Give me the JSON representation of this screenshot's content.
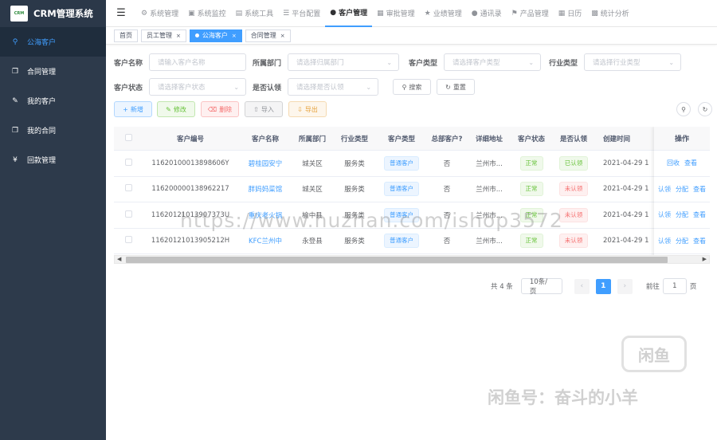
{
  "app": {
    "logo_text": "CRM",
    "title": "CRM管理系统"
  },
  "sidebar": {
    "items": [
      {
        "label": "公海客户",
        "icon": "sitemap-icon"
      },
      {
        "label": "合同管理",
        "icon": "copy-icon"
      },
      {
        "label": "我的客户",
        "icon": "edit-icon"
      },
      {
        "label": "我的合同",
        "icon": "copy-icon"
      },
      {
        "label": "回款管理",
        "icon": "yen-icon"
      }
    ]
  },
  "topnav": {
    "items": [
      {
        "label": "系统管理",
        "icon": "gear-icon"
      },
      {
        "label": "系统监控",
        "icon": "monitor-icon"
      },
      {
        "label": "系统工具",
        "icon": "toolbox-icon"
      },
      {
        "label": "平台配置",
        "icon": "list-icon"
      },
      {
        "label": "客户管理",
        "icon": "user-icon"
      },
      {
        "label": "审批管理",
        "icon": "grid-icon"
      },
      {
        "label": "业绩管理",
        "icon": "star-icon"
      },
      {
        "label": "通讯录",
        "icon": "user-icon"
      },
      {
        "label": "产品管理",
        "icon": "tag-icon"
      },
      {
        "label": "日历",
        "icon": "calendar-icon"
      },
      {
        "label": "统计分析",
        "icon": "bar-chart-icon"
      }
    ]
  },
  "tags": [
    {
      "label": "首页"
    },
    {
      "label": "员工管理",
      "close": "×"
    },
    {
      "label": "公海客户",
      "close": "×"
    },
    {
      "label": "合同管理",
      "close": "×"
    }
  ],
  "filters": {
    "customer_name": {
      "label": "客户名称",
      "placeholder": "请输入客户名称"
    },
    "department": {
      "label": "所属部门",
      "placeholder": "请选择归属部门"
    },
    "customer_type": {
      "label": "客户类型",
      "placeholder": "请选择客户类型"
    },
    "industry_type": {
      "label": "行业类型",
      "placeholder": "请选择行业类型"
    },
    "customer_status": {
      "label": "客户状态",
      "placeholder": "请选择客户状态"
    },
    "claimed": {
      "label": "是否认领",
      "placeholder": "请选择是否认领"
    },
    "search_label": "搜索",
    "reset_label": "重置"
  },
  "toolbar": {
    "add": "新增",
    "edit": "修改",
    "delete": "删除",
    "import": "导入",
    "export": "导出"
  },
  "table": {
    "columns": [
      "客户编号",
      "客户名称",
      "所属部门",
      "行业类型",
      "客户类型",
      "总部客户?",
      "详细地址",
      "客户状态",
      "是否认领",
      "创建时间",
      "操作"
    ],
    "rows": [
      {
        "id": "11620100013898606Y",
        "name": "碧桂园安宁",
        "dept": "城关区",
        "industry": "服务类",
        "type": "普通客户",
        "hq": "否",
        "addr": "兰州市...",
        "status": "正常",
        "claimed": "已认领",
        "created": "2021-04-29 1",
        "ops": [
          "回收",
          "查看"
        ]
      },
      {
        "id": "116200000138962217",
        "name": "胖妈妈菜馆",
        "dept": "城关区",
        "industry": "服务类",
        "type": "普通客户",
        "hq": "否",
        "addr": "兰州市...",
        "status": "正常",
        "claimed": "未认领",
        "created": "2021-04-29 1",
        "ops": [
          "认领",
          "分配",
          "查看"
        ]
      },
      {
        "id": "11620121013907373U",
        "name": "重庆老火锅",
        "dept": "榆中县",
        "industry": "服务类",
        "type": "普通客户",
        "hq": "否",
        "addr": "兰州市...",
        "status": "正常",
        "claimed": "未认领",
        "created": "2021-04-29 1",
        "ops": [
          "认领",
          "分配",
          "查看"
        ]
      },
      {
        "id": "11620121013905212H",
        "name": "KFC兰州中",
        "dept": "永登县",
        "industry": "服务类",
        "type": "普通客户",
        "hq": "否",
        "addr": "兰州市...",
        "status": "正常",
        "claimed": "未认领",
        "created": "2021-04-29 1",
        "ops": [
          "认领",
          "分配",
          "查看"
        ]
      }
    ]
  },
  "pagination": {
    "total": "共 4 条",
    "page_size": "10条/页",
    "current": "1",
    "goto_prefix": "前往",
    "goto_value": "1",
    "goto_suffix": "页"
  },
  "watermark": {
    "url": "https://www.huzhan.com/ishop3572",
    "logo": "闲鱼",
    "tagline": "闲鱼号：奋斗的小羊"
  },
  "colors": {
    "primary": "#409eff",
    "sidebar_bg": "#2d3a4b",
    "success": "#67c23a",
    "danger": "#f56c6c",
    "warning": "#e6a23c"
  }
}
